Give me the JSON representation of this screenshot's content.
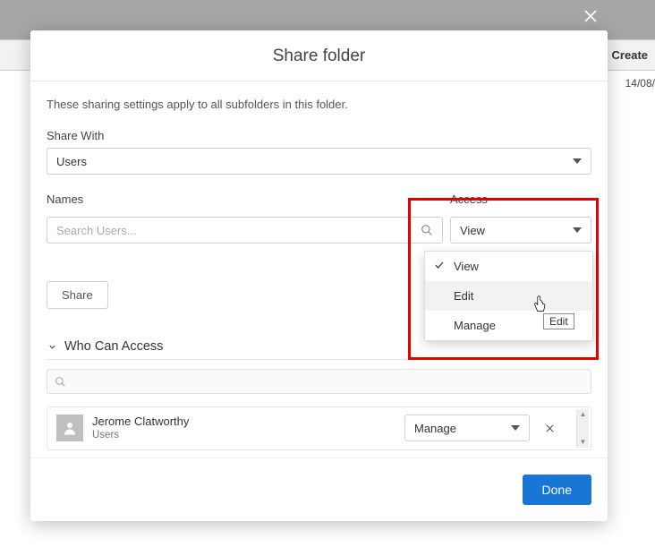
{
  "background": {
    "header_col": "Create",
    "date": "14/08/"
  },
  "modal": {
    "title": "Share folder",
    "subtitle": "These sharing settings apply to all subfolders in this folder.",
    "share_with_label": "Share With",
    "share_with_value": "Users",
    "names_label": "Names",
    "names_placeholder": "Search Users...",
    "access_label": "Access",
    "access_value": "View",
    "share_button": "Share",
    "who_header": "Who Can Access",
    "done_button": "Done"
  },
  "access_dropdown": {
    "options": [
      "View",
      "Edit",
      "Manage"
    ],
    "selected": "View",
    "hovered": "Edit",
    "tooltip": "Edit"
  },
  "who_list": [
    {
      "name": "Jerome Clatworthy",
      "role": "Users",
      "access": "Manage"
    }
  ]
}
